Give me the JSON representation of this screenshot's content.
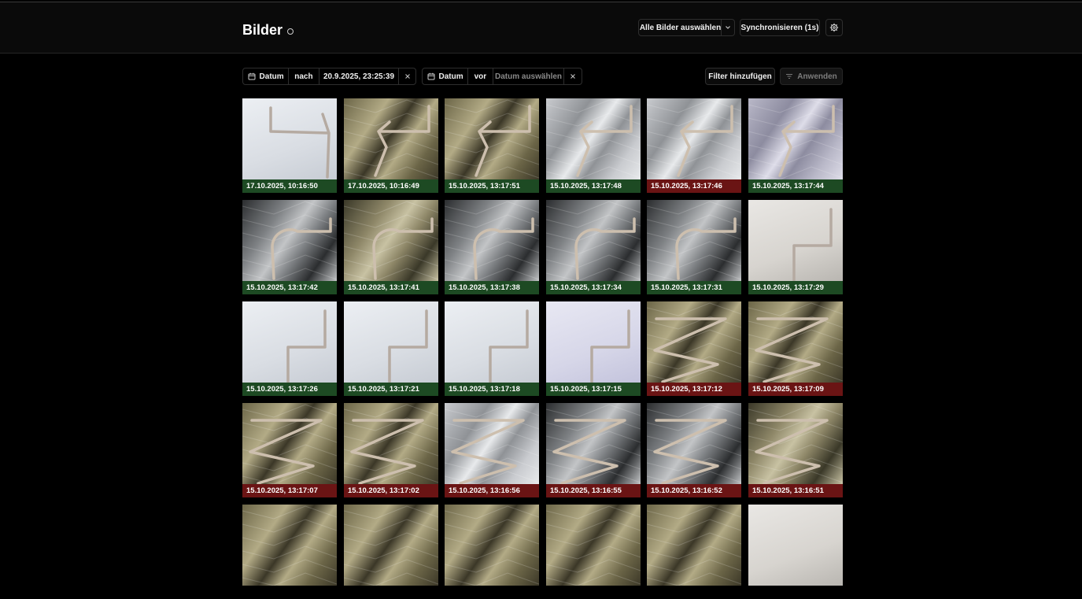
{
  "header": {
    "title": "Bilder",
    "select_all_label": "Alle Bilder auswählen",
    "sync_label": "Synchronisieren (1s)"
  },
  "filters": {
    "filter1": {
      "field": "Datum",
      "operator": "nach",
      "value": "20.9.2025, 23:25:39"
    },
    "filter2": {
      "field": "Datum",
      "operator": "vor",
      "placeholder": "Datum auswählen"
    },
    "add_filter_label": "Filter hinzufügen",
    "apply_label": "Anwenden"
  },
  "colors": {
    "ok": "#1d4a23",
    "fail": "#6a1414"
  },
  "images": [
    {
      "label": "17.10.2025, 10:16:50",
      "status": "green",
      "bg": "white",
      "shape": "s"
    },
    {
      "label": "17.10.2025, 10:16:49",
      "status": "green",
      "bg": "foil-gold",
      "shape": "arrow"
    },
    {
      "label": "15.10.2025, 13:17:51",
      "status": "green",
      "bg": "foil-gold",
      "shape": "arrow"
    },
    {
      "label": "15.10.2025, 13:17:48",
      "status": "green",
      "bg": "foil-light",
      "shape": "arrow"
    },
    {
      "label": "15.10.2025, 13:17:46",
      "status": "red",
      "bg": "foil-light",
      "shape": "arrow"
    },
    {
      "label": "15.10.2025, 13:17:44",
      "status": "green",
      "bg": "foil-lavender",
      "shape": "arrow"
    },
    {
      "label": "15.10.2025, 13:17:42",
      "status": "green",
      "bg": "foil-dark",
      "shape": "hook"
    },
    {
      "label": "15.10.2025, 13:17:41",
      "status": "green",
      "bg": "foil-dark-gold",
      "shape": "hook"
    },
    {
      "label": "15.10.2025, 13:17:38",
      "status": "green",
      "bg": "foil-dark",
      "shape": "hook"
    },
    {
      "label": "15.10.2025, 13:17:34",
      "status": "green",
      "bg": "foil-dark",
      "shape": "hook"
    },
    {
      "label": "15.10.2025, 13:17:31",
      "status": "green",
      "bg": "foil-dark",
      "shape": "hook"
    },
    {
      "label": "15.10.2025, 13:17:29",
      "status": "green",
      "bg": "white-grey",
      "shape": "z"
    },
    {
      "label": "15.10.2025, 13:17:26",
      "status": "green",
      "bg": "white",
      "shape": "z"
    },
    {
      "label": "15.10.2025, 13:17:21",
      "status": "green",
      "bg": "white",
      "shape": "z"
    },
    {
      "label": "15.10.2025, 13:17:18",
      "status": "green",
      "bg": "white",
      "shape": "z"
    },
    {
      "label": "15.10.2025, 13:17:15",
      "status": "green",
      "bg": "white-lavender",
      "shape": "z"
    },
    {
      "label": "15.10.2025, 13:17:12",
      "status": "red",
      "bg": "foil-gold",
      "shape": "zz"
    },
    {
      "label": "15.10.2025, 13:17:09",
      "status": "red",
      "bg": "foil-gold",
      "shape": "zz"
    },
    {
      "label": "15.10.2025, 13:17:07",
      "status": "red",
      "bg": "foil-gold",
      "shape": "zz"
    },
    {
      "label": "15.10.2025, 13:17:02",
      "status": "red",
      "bg": "foil-gold",
      "shape": "zz"
    },
    {
      "label": "15.10.2025, 13:16:56",
      "status": "red",
      "bg": "foil-light",
      "shape": "zz"
    },
    {
      "label": "15.10.2025, 13:16:55",
      "status": "red",
      "bg": "foil-dark",
      "shape": "zz"
    },
    {
      "label": "15.10.2025, 13:16:52",
      "status": "red",
      "bg": "foil-dark",
      "shape": "zz"
    },
    {
      "label": "15.10.2025, 13:16:51",
      "status": "red",
      "bg": "foil-dark-gold",
      "shape": "zz"
    },
    {
      "label": "",
      "status": "",
      "bg": "foil-gold",
      "shape": "none"
    },
    {
      "label": "",
      "status": "",
      "bg": "foil-gold",
      "shape": "none"
    },
    {
      "label": "",
      "status": "",
      "bg": "foil-gold",
      "shape": "none"
    },
    {
      "label": "",
      "status": "",
      "bg": "foil-gold",
      "shape": "none"
    },
    {
      "label": "",
      "status": "",
      "bg": "foil-gold",
      "shape": "none"
    },
    {
      "label": "",
      "status": "",
      "bg": "white-grey",
      "shape": "none"
    }
  ]
}
